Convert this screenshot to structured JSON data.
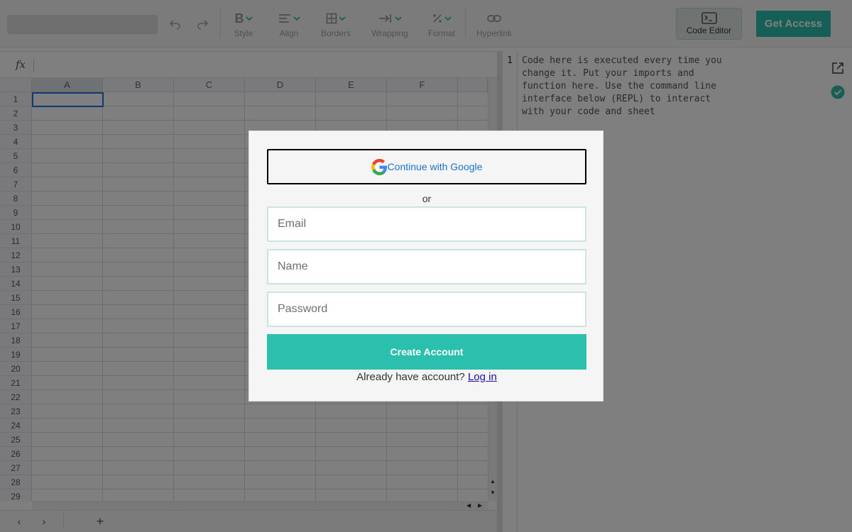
{
  "toolbar": {
    "tools": [
      {
        "label": "Style",
        "icon": "bold-icon"
      },
      {
        "label": "Align",
        "icon": "align-icon"
      },
      {
        "label": "Borders",
        "icon": "borders-icon"
      },
      {
        "label": "Wrapping",
        "icon": "wrapping-icon"
      },
      {
        "label": "Format",
        "icon": "percent-format-icon"
      },
      {
        "label": "Hyperlink",
        "icon": "link-icon"
      }
    ],
    "code_editor_label": "Code Editor",
    "get_access_label": "Get Access"
  },
  "formula_bar": {
    "fx": "fx"
  },
  "grid": {
    "columns": [
      "A",
      "B",
      "C",
      "D",
      "E",
      "F"
    ],
    "rows": [
      "1",
      "2",
      "3",
      "4",
      "5",
      "6",
      "7",
      "8",
      "9",
      "10",
      "11",
      "12",
      "13",
      "14",
      "15",
      "16",
      "17",
      "18",
      "19",
      "20",
      "21",
      "22",
      "23",
      "24",
      "25",
      "26",
      "27",
      "28",
      "29"
    ]
  },
  "editor": {
    "line_number": "1",
    "code": "Code here is executed every time you\nchange it. Put your imports and\nfunction here. Use the command line\ninterface below (REPL) to interact\nwith your code and sheet"
  },
  "modal": {
    "google_label": "Continue with Google",
    "or_label": "or",
    "email_placeholder": "Email",
    "name_placeholder": "Name",
    "password_placeholder": "Password",
    "create_label": "Create Account",
    "already_text": "Already have account?",
    "login_label": "Log in"
  },
  "colors": {
    "accent": "#2bbfad",
    "link": "#1a0dab",
    "google_text": "#1a73c8"
  }
}
